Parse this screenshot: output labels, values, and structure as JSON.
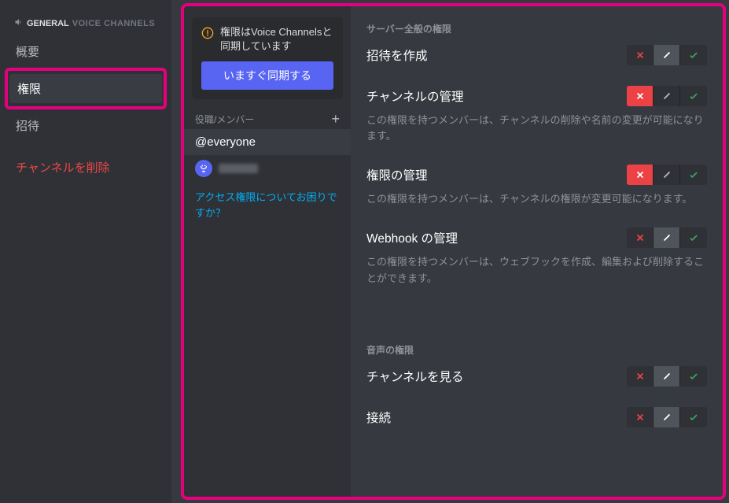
{
  "sidebar": {
    "channel_prefix": "GENERAL",
    "channel_suffix": "VOICE CHANNELS",
    "items": {
      "overview": "概要",
      "permissions": "権限",
      "invites": "招待",
      "delete": "チャンネルを削除"
    }
  },
  "mid": {
    "sync_text": "権限はVoice Channelsと同期しています",
    "sync_button": "いますぐ同期する",
    "roles_header": "役職/メンバー",
    "everyone": "@everyone",
    "help_link": "アクセス権限についてお困りですか？"
  },
  "perm": {
    "section_general": "サーバー全般の権限",
    "create_invite": {
      "title": "招待を作成",
      "state": "neutral"
    },
    "manage_channel": {
      "title": "チャンネルの管理",
      "desc": "この権限を持つメンバーは、チャンネルの削除や名前の変更が可能になります。",
      "state": "deny"
    },
    "manage_permissions": {
      "title": "権限の管理",
      "desc": "この権限を持つメンバーは、チャンネルの権限が変更可能になります。",
      "state": "deny"
    },
    "manage_webhooks": {
      "title": "Webhook の管理",
      "desc": "この権限を持つメンバーは、ウェブフックを作成、編集および削除することができます。",
      "state": "neutral"
    },
    "section_voice": "音声の権限",
    "view_channel": {
      "title": "チャンネルを見る",
      "state": "neutral"
    },
    "connect": {
      "title": "接続",
      "state": "neutral"
    }
  }
}
